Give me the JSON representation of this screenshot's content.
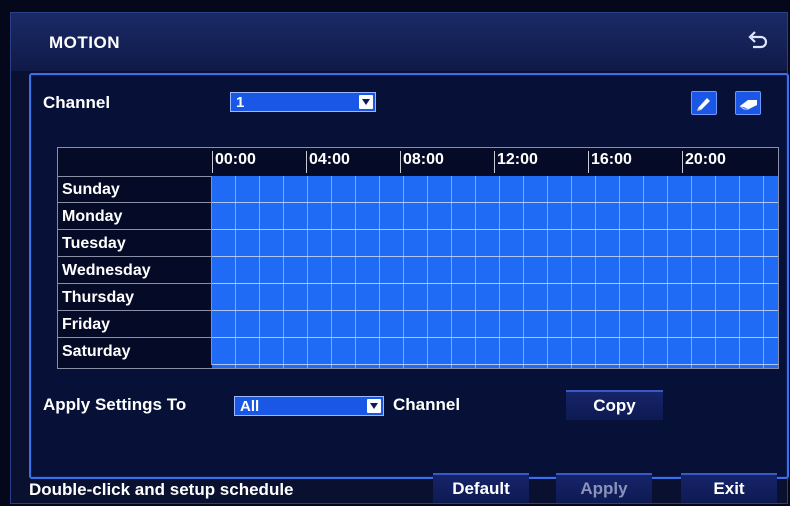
{
  "window": {
    "title": "MOTION"
  },
  "channel": {
    "label": "Channel",
    "value": "1"
  },
  "schedule": {
    "hours": [
      "00:00",
      "04:00",
      "08:00",
      "12:00",
      "16:00",
      "20:00"
    ],
    "days": [
      "Sunday",
      "Monday",
      "Tuesday",
      "Wednesday",
      "Thursday",
      "Friday",
      "Saturday"
    ],
    "fill_color": "#1f6bf5"
  },
  "apply": {
    "label": "Apply Settings To",
    "value": "All",
    "suffix": "Channel",
    "copy_label": "Copy"
  },
  "footer": {
    "hint": "Double-click and setup schedule",
    "default_label": "Default",
    "apply_label": "Apply",
    "exit_label": "Exit"
  },
  "icons": {
    "back": "back-arrow-icon",
    "pencil": "pencil-icon",
    "eraser": "eraser-icon"
  }
}
